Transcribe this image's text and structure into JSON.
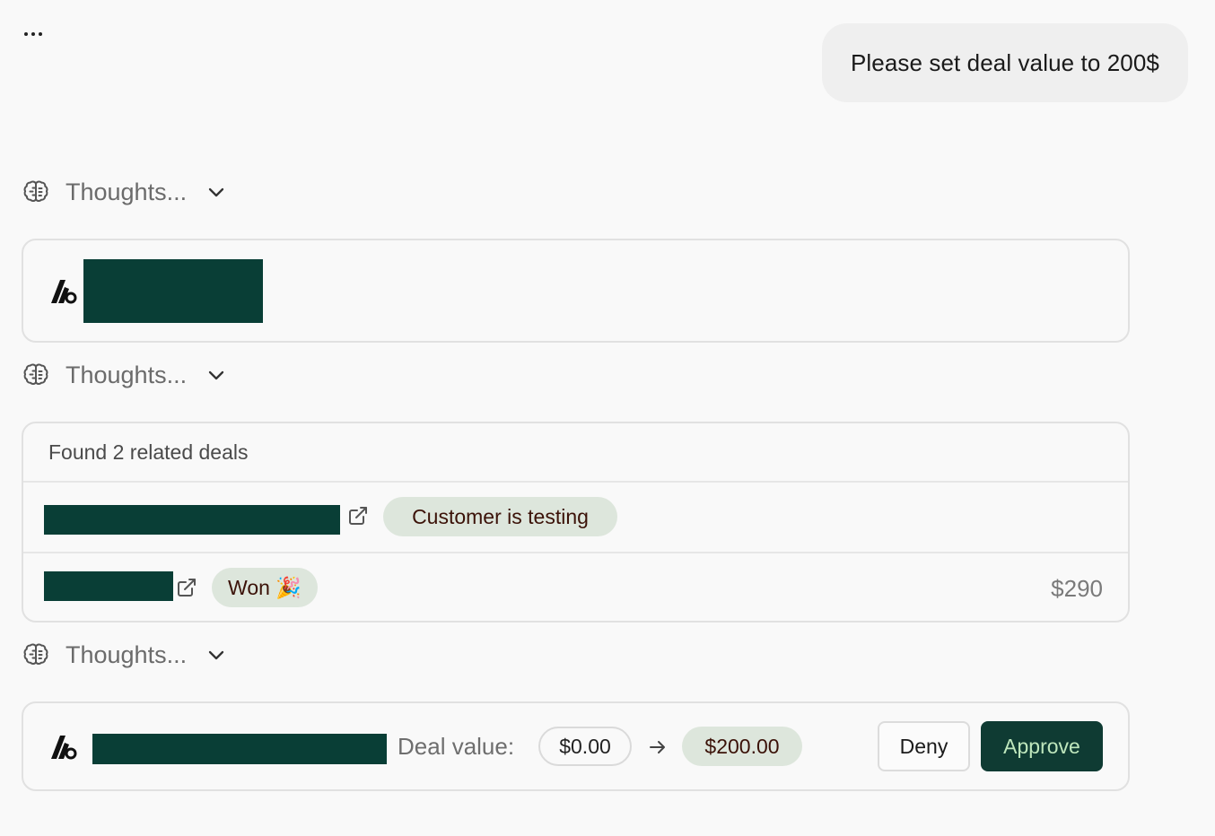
{
  "header": {
    "more_icon": "more-horizontal-icon"
  },
  "user_message": {
    "text": "Please set deal value to 200$"
  },
  "thoughts": [
    {
      "label": "Thoughts...",
      "icon": "brain-icon",
      "toggle_icon": "chevron-down-icon"
    },
    {
      "label": "Thoughts...",
      "icon": "brain-icon",
      "toggle_icon": "chevron-down-icon"
    },
    {
      "label": "Thoughts...",
      "icon": "brain-icon",
      "toggle_icon": "chevron-down-icon"
    }
  ],
  "lookup_card": {
    "logo_icon": "app-logo-icon",
    "redacted_color": "#093e36"
  },
  "related_deals": {
    "header": "Found 2 related deals",
    "deals": [
      {
        "stage": "Customer is testing",
        "value": "",
        "link_icon": "external-link-icon"
      },
      {
        "stage": "Won 🎉",
        "value": "$290",
        "link_icon": "external-link-icon"
      }
    ]
  },
  "update_card": {
    "logo_icon": "app-logo-icon",
    "field_label": "Deal value:",
    "old_value": "$0.00",
    "arrow_icon": "arrow-right-icon",
    "new_value": "$200.00",
    "deny_label": "Deny",
    "approve_label": "Approve"
  },
  "colors": {
    "background": "#f9f9f9",
    "redaction": "#093e36",
    "pill_background": "#dde6dc",
    "pill_text": "#3b1208",
    "approve_background": "#0f3b33",
    "approve_text": "#bfe7bd"
  }
}
